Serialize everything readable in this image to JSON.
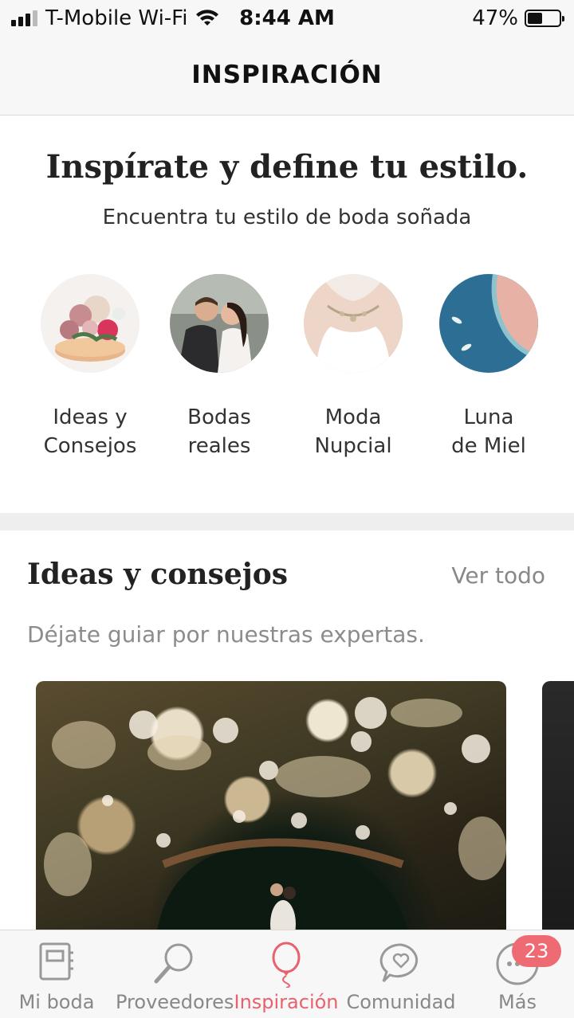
{
  "status_bar": {
    "carrier": "T-Mobile Wi-Fi",
    "time": "8:44 AM",
    "battery_percent": "47%",
    "battery_level": 0.47
  },
  "header": {
    "title": "INSPIRACIÓN"
  },
  "hero": {
    "title": "Inspírate y define tu estilo.",
    "subtitle": "Encuentra tu estilo de boda soñada"
  },
  "categories": [
    {
      "line1": "Ideas y",
      "line2": "Consejos"
    },
    {
      "line1": "Bodas",
      "line2": "reales"
    },
    {
      "line1": "Moda",
      "line2": "Nupcial"
    },
    {
      "line1": "Luna",
      "line2": "de Miel"
    }
  ],
  "ideas_section": {
    "title": "Ideas y consejos",
    "see_all": "Ver todo",
    "subtitle": "Déjate guiar por nuestras expertas."
  },
  "tab_bar": {
    "tabs": [
      {
        "label": "Mi boda",
        "icon": "planner-book-icon"
      },
      {
        "label": "Proveedores",
        "icon": "magnifier-icon"
      },
      {
        "label": "Inspiración",
        "icon": "balloon-icon"
      },
      {
        "label": "Comunidad",
        "icon": "chat-heart-icon"
      },
      {
        "label": "Más",
        "icon": "more-dots-icon"
      }
    ],
    "active_tab": "Inspiración",
    "more_badge": "23"
  },
  "colors": {
    "accent": "#e8616d",
    "badge": "#ef6b74",
    "bar_background": "#f7f7f7"
  }
}
